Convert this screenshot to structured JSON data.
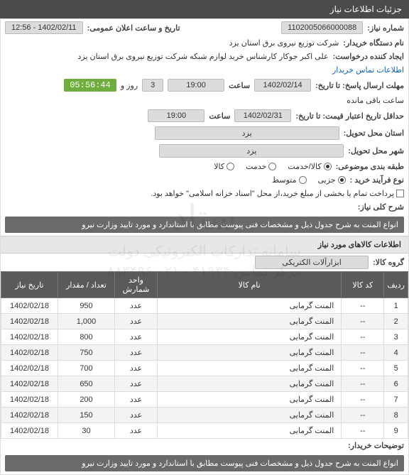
{
  "header": {
    "title": "جزئیات اطلاعات نیاز"
  },
  "fields": {
    "need_number_label": "شماره نیاز:",
    "need_number": "1102005066000088",
    "announce_label": "تاریخ و ساعت اعلان عمومی:",
    "announce_value": "1402/02/11 - 12:56",
    "buyer_org_label": "نام دستگاه خریدار:",
    "buyer_org": "شرکت توزیع نیروی برق استان یزد",
    "creator_label": "ایجاد کننده درخواست:",
    "creator": "علی اکبر جوکار  کارشناس خرید لوازم شبکه  شرکت توزیع نیروی برق استان یزد",
    "contact_link": "اطلاعات تماس خریدار",
    "deadline_label": "مهلت ارسال پاسخ: تا تاریخ:",
    "deadline_date": "1402/02/14",
    "deadline_time_label": "ساعت",
    "deadline_time": "19:00",
    "remain_num": "3",
    "remain_unit": "روز و",
    "countdown": "05:56:44",
    "remain_suffix": "ساعت باقی مانده",
    "validity_label": "حداقل تاریخ اعتبار قیمت: تا تاریخ:",
    "validity_date": "1402/02/31",
    "validity_time_label": "ساعت",
    "validity_time": "19:00",
    "delivery_province_label": "استان محل تحویل:",
    "delivery_province": "یزد",
    "delivery_city_label": "شهر محل تحویل:",
    "delivery_city": "یزد",
    "budget_label": "طبقه بندی موضوعی:",
    "budget_goods": "کالا/خدمت",
    "budget_service": "خدمت",
    "budget_goods_only": "کالا",
    "process_label": "نوع فرآیند خرید :",
    "process_small": "جزیی",
    "process_medium": "متوسط",
    "process_note": "پرداخت تمام یا بخشی از مبلغ خرید،از محل \"اسناد خزانه اسلامی\" خواهد بود.",
    "need_desc_label": "شرح کلی نیاز:",
    "need_desc": "انواع المنت   به شرح جدول ذیل و مشخصات فنی پیوست مطابق با استاندارد و مورد تایید وزارت نیرو",
    "items_header": "اطلاعات کالاهای مورد نیاز",
    "goods_group_label": "گروه کالا:",
    "goods_group": "ابزارآلات الکتریکی",
    "buyer_notes_label": "توضیحات خریدار:",
    "bottom_desc": "انواع المنت   به شرح جدول ذیل و مشخصات فنی پیوست مطابق با استاندارد و مورد تایید وزارت نیرو"
  },
  "table": {
    "headers": {
      "idx": "ردیف",
      "code": "کد کالا",
      "name": "نام کالا",
      "unit": "واحد شمارش",
      "qty": "تعداد / مقدار",
      "date": "تاریخ نیاز"
    },
    "rows": [
      {
        "idx": "1",
        "code": "--",
        "name": "المنت گرمایی",
        "unit": "عدد",
        "qty": "950",
        "date": "1402/02/18"
      },
      {
        "idx": "2",
        "code": "--",
        "name": "المنت گرمایی",
        "unit": "عدد",
        "qty": "1,000",
        "date": "1402/02/18"
      },
      {
        "idx": "3",
        "code": "--",
        "name": "المنت گرمایی",
        "unit": "عدد",
        "qty": "800",
        "date": "1402/02/18"
      },
      {
        "idx": "4",
        "code": "--",
        "name": "المنت گرمایی",
        "unit": "عدد",
        "qty": "750",
        "date": "1402/02/18"
      },
      {
        "idx": "5",
        "code": "--",
        "name": "المنت گرمایی",
        "unit": "عدد",
        "qty": "700",
        "date": "1402/02/18"
      },
      {
        "idx": "6",
        "code": "--",
        "name": "المنت گرمایی",
        "unit": "عدد",
        "qty": "650",
        "date": "1402/02/18"
      },
      {
        "idx": "7",
        "code": "--",
        "name": "المنت گرمایی",
        "unit": "عدد",
        "qty": "200",
        "date": "1402/02/18"
      },
      {
        "idx": "8",
        "code": "--",
        "name": "المنت گرمایی",
        "unit": "عدد",
        "qty": "150",
        "date": "1402/02/18"
      },
      {
        "idx": "9",
        "code": "--",
        "name": "المنت گرمایی",
        "unit": "عدد",
        "qty": "30",
        "date": "1402/02/18"
      }
    ]
  },
  "watermark": {
    "main": "ستاد",
    "sub": "سامانه تدارکات الکترونیکی دولت",
    "phone": "مرکز تماس ۴۱۹۳۴ - ۰۲۱   ۸۸٣۴٩۶"
  }
}
